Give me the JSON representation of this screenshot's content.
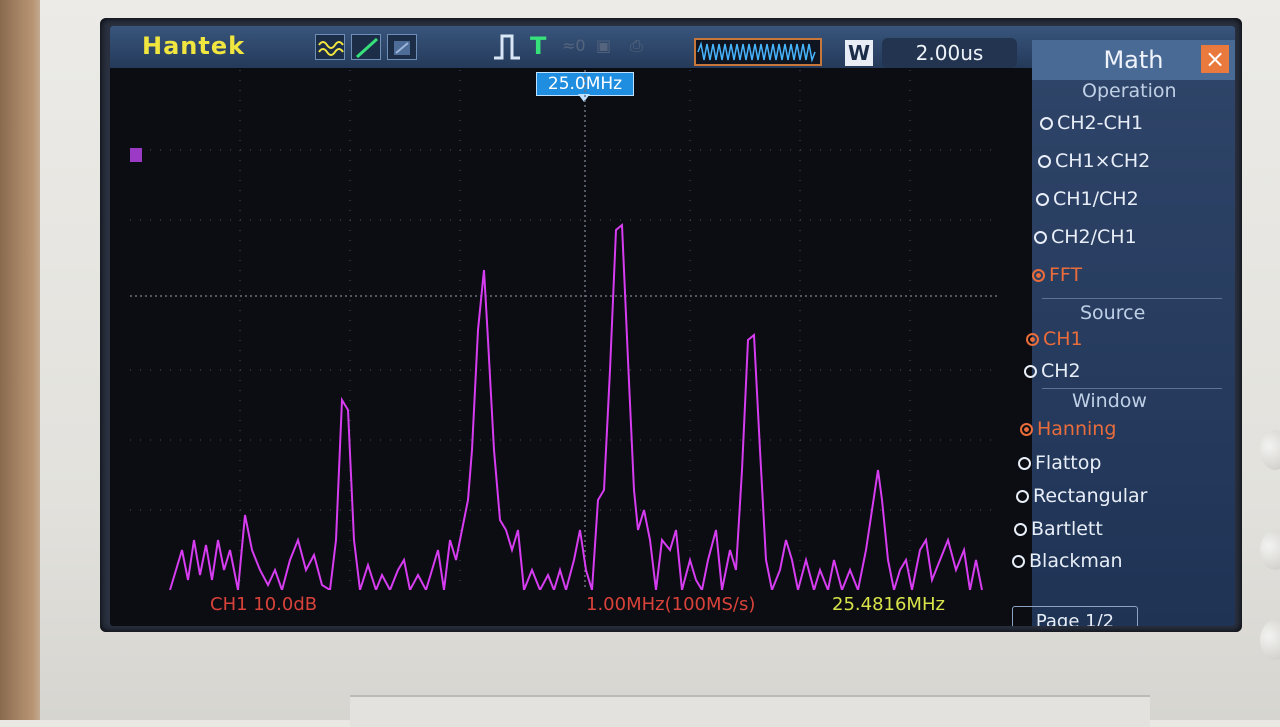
{
  "brand": "Hantek",
  "topbar": {
    "trigger_label": "T",
    "timebase": "2.00us",
    "wave_button": "W",
    "trigger_marker": "25.0MHz"
  },
  "menu": {
    "title": "Math",
    "close_label": "×",
    "operation": {
      "title": "Operation",
      "options": [
        "CH2-CH1",
        "CH1×CH2",
        "CH1/CH2",
        "CH2/CH1",
        "FFT"
      ],
      "selected": "FFT"
    },
    "source": {
      "title": "Source",
      "options": [
        "CH1",
        "CH2"
      ],
      "selected": "CH1"
    },
    "window": {
      "title": "Window",
      "options": [
        "Hanning",
        "Flattop",
        "Rectangular",
        "Bartlett",
        "Blackman"
      ],
      "selected": "Hanning"
    },
    "page": "Page 1/2"
  },
  "status": {
    "scale": "CH1 10.0dB",
    "freq_div": "1.00MHz(100MS/s)",
    "cursor_freq": "25.4816MHz"
  },
  "colors": {
    "trace": "#d63cf0",
    "brand": "#f1e640",
    "trigger": "#36e07a",
    "selected": "#e96c3b",
    "status_red": "#d9423a",
    "status_yellow": "#d9e44a"
  }
}
